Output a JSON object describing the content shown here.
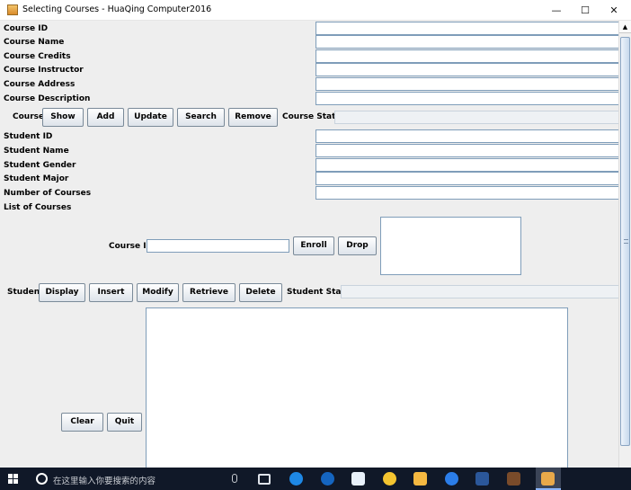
{
  "window": {
    "title": "Selecting Courses - HuaQing Computer2016",
    "minimize_glyph": "—",
    "maximize_glyph": "☐",
    "close_glyph": "✕"
  },
  "course_section": {
    "labels": {
      "course_id": "Course ID",
      "course_name": "Course Name",
      "course_credits": "Course Credits",
      "course_instructor": "Course Instructor",
      "course_address": "Course Address",
      "course_description": "Course Description"
    },
    "values": {
      "course_id": "",
      "course_name": "",
      "course_credits": "",
      "course_instructor": "",
      "course_address": "",
      "course_description": ""
    },
    "toolbar": {
      "course_label": "Course",
      "show": "Show",
      "add": "Add",
      "update": "Update",
      "search": "Search",
      "remove": "Remove",
      "state_label": "Course State:",
      "state_value": ""
    }
  },
  "student_section": {
    "labels": {
      "student_id": "Student ID",
      "student_name": "Student Name",
      "student_gender": "Student Gender",
      "student_major": "Student Major",
      "number_of_courses": "Number of Courses",
      "list_of_courses": "List of Courses"
    },
    "values": {
      "student_id": "",
      "student_name": "",
      "student_gender": "",
      "student_major": "",
      "number_of_courses": ""
    },
    "enroll": {
      "course_id_label": "Course ID",
      "course_id_value": "",
      "enroll": "Enroll",
      "drop": "Drop"
    },
    "toolbar": {
      "student_label": "Student",
      "display": "Display",
      "insert": "Insert",
      "modify": "Modify",
      "retrieve": "Retrieve",
      "delete": "Delete",
      "state_label": "Student State:",
      "state_value": ""
    }
  },
  "bottom": {
    "clear": "Clear",
    "quit": "Quit"
  },
  "scrollbar": {
    "up_arrow": "▲"
  },
  "taskbar": {
    "search_placeholder": "在这里输入你要搜索的内容",
    "icons": [
      "windows-start-icon",
      "cortana-icon",
      "microphone-icon",
      "task-view-icon",
      "edge-icon",
      "kugou-icon",
      "feishu-icon",
      "chat-icon",
      "file-explorer-icon",
      "sogou-icon",
      "word-icon",
      "game-icon",
      "java-app-icon"
    ]
  },
  "colors": {
    "client_bg": "#eeeeee",
    "field_border": "#7f9db9",
    "taskbar_bg": "#101828"
  }
}
